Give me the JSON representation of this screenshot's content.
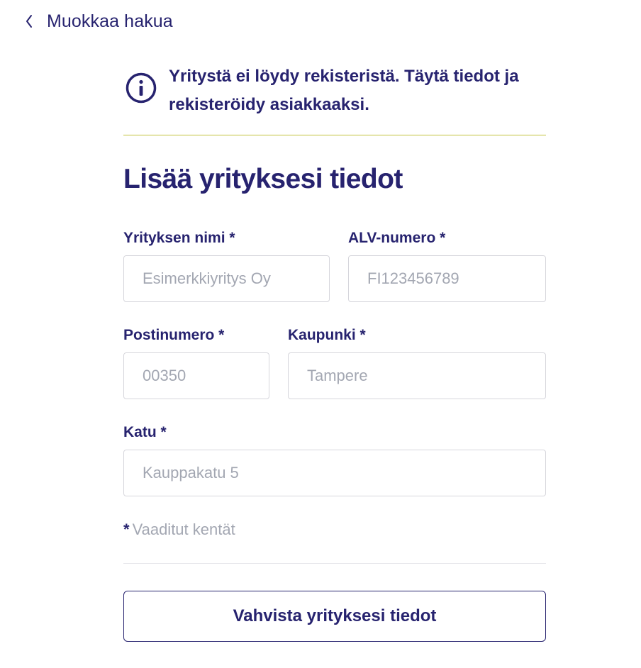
{
  "nav": {
    "back_label": "Muokkaa hakua",
    "back_icon": "chevron-left-icon"
  },
  "notice": {
    "icon": "info-icon",
    "message": "Yritystä ei löydy rekisteristä. Täytä tiedot ja rekisteröidy asiakkaaksi."
  },
  "form": {
    "title": "Lisää yrityksesi tiedot",
    "fields": {
      "company_name": {
        "label": "Yrityksen nimi *",
        "placeholder": "Esimerkkiyritys Oy",
        "value": ""
      },
      "vat_number": {
        "label": "ALV-numero *",
        "placeholder": "FI123456789",
        "value": ""
      },
      "postal_code": {
        "label": "Postinumero *",
        "placeholder": "00350",
        "value": ""
      },
      "city": {
        "label": "Kaupunki *",
        "placeholder": "Tampere",
        "value": ""
      },
      "street": {
        "label": "Katu *",
        "placeholder": "Kauppakatu 5",
        "value": ""
      }
    },
    "required_star": "*",
    "required_note": "Vaaditut kentät",
    "submit_label": "Vahvista yrityksesi tiedot"
  },
  "colors": {
    "primary": "#27236f",
    "placeholder": "#a3a7b2",
    "notice_rule": "#c2c23a",
    "input_border": "#d6d6dc"
  }
}
